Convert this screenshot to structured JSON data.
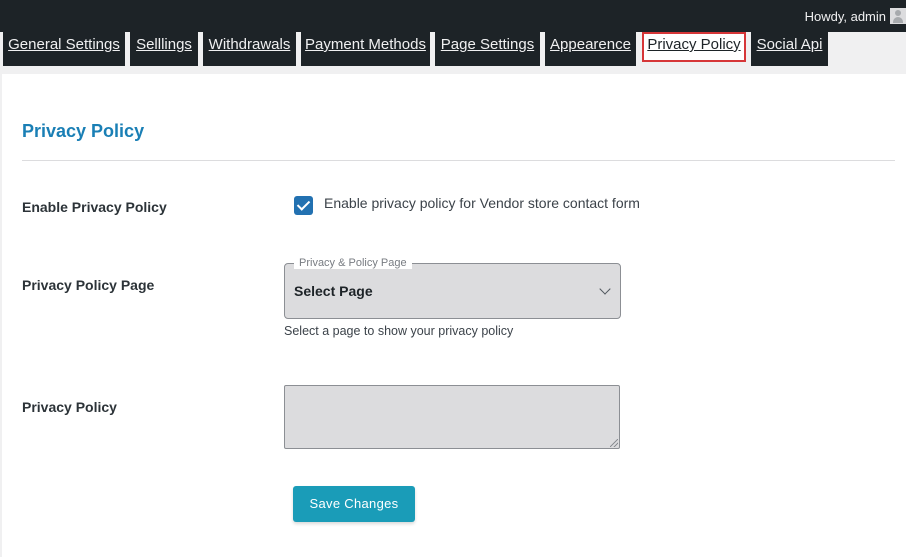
{
  "adminbar": {
    "greeting": "Howdy, admin"
  },
  "tabs": [
    {
      "label": "General Settings"
    },
    {
      "label": "Selllings"
    },
    {
      "label": "Withdrawals"
    },
    {
      "label": "Payment Methods"
    },
    {
      "label": "Page Settings"
    },
    {
      "label": "Appearence"
    },
    {
      "label": "Privacy Policy",
      "active": true
    },
    {
      "label": "Social Api"
    }
  ],
  "section": {
    "title": "Privacy Policy"
  },
  "enable_row": {
    "label": "Enable Privacy Policy",
    "checked": true,
    "checkbox_label": "Enable privacy policy for Vendor store contact form"
  },
  "page_row": {
    "label": "Privacy Policy Page",
    "select_legend": "Privacy & Policy Page",
    "select_value": "Select Page",
    "help_text": "Select a page to show your privacy policy"
  },
  "policy_row": {
    "label": "Privacy Policy",
    "textarea_value": ""
  },
  "save_button": {
    "label": "Save Changes"
  },
  "colors": {
    "admin_bar": "#1d2327",
    "title_blue": "#1a7fb5",
    "checkbox": "#2271b1",
    "button": "#1a9cb8",
    "active_tab_border": "#d63638"
  }
}
